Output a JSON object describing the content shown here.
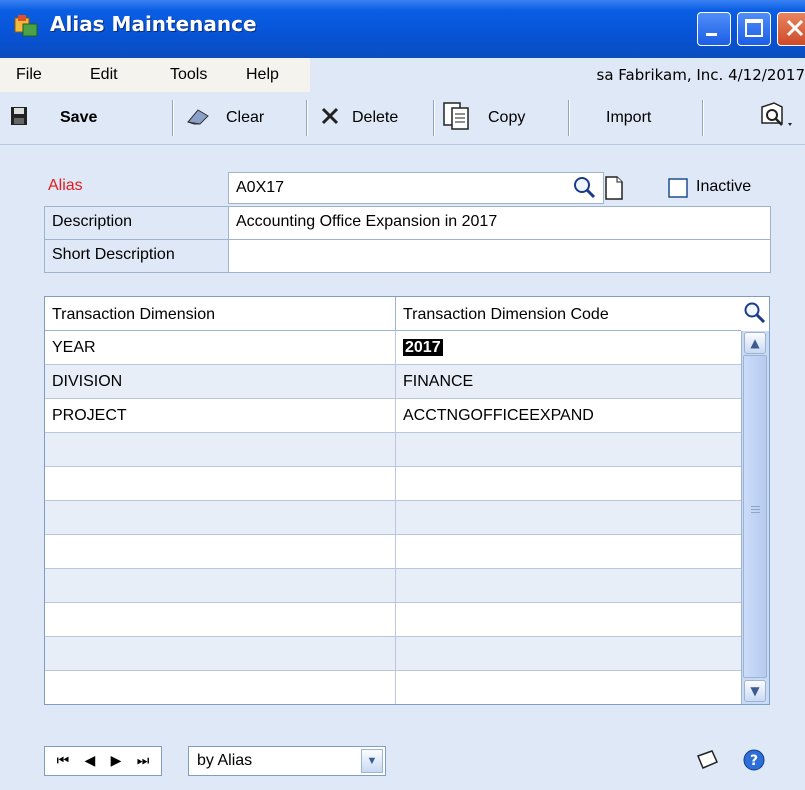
{
  "window": {
    "title": "Alias Maintenance",
    "minimize_icon": "minimize-icon",
    "maximize_icon": "maximize-icon",
    "close_icon": "close-icon"
  },
  "menu": {
    "items": [
      "File",
      "Edit",
      "Tools",
      "Help"
    ],
    "company_info": "sa  Fabrikam, Inc.  4/12/2017"
  },
  "toolbar": {
    "save": "Save",
    "clear": "Clear",
    "delete": "Delete",
    "copy": "Copy",
    "import": "Import"
  },
  "form": {
    "alias_label": "Alias",
    "alias_value": "A0X17",
    "inactive_label": "Inactive",
    "inactive_checked": false,
    "description_label": "Description",
    "description_value": "Accounting Office Expansion in 2017",
    "short_description_label": "Short Description",
    "short_description_value": ""
  },
  "grid": {
    "headers": [
      "Transaction Dimension",
      "Transaction Dimension Code"
    ],
    "rows": [
      [
        "YEAR",
        "2017"
      ],
      [
        "DIVISION",
        "FINANCE"
      ],
      [
        "PROJECT",
        "ACCTNGOFFICEEXPAND"
      ],
      [
        "",
        ""
      ],
      [
        "",
        ""
      ],
      [
        "",
        ""
      ],
      [
        "",
        ""
      ],
      [
        "",
        ""
      ],
      [
        "",
        ""
      ],
      [
        "",
        ""
      ],
      [
        "",
        ""
      ]
    ],
    "selected_code": "2017"
  },
  "footer": {
    "sort_by": "by Alias"
  },
  "colors": {
    "title_bar": "#0753d6",
    "required_label": "#e01c1c",
    "background": "#dfe8f6"
  }
}
